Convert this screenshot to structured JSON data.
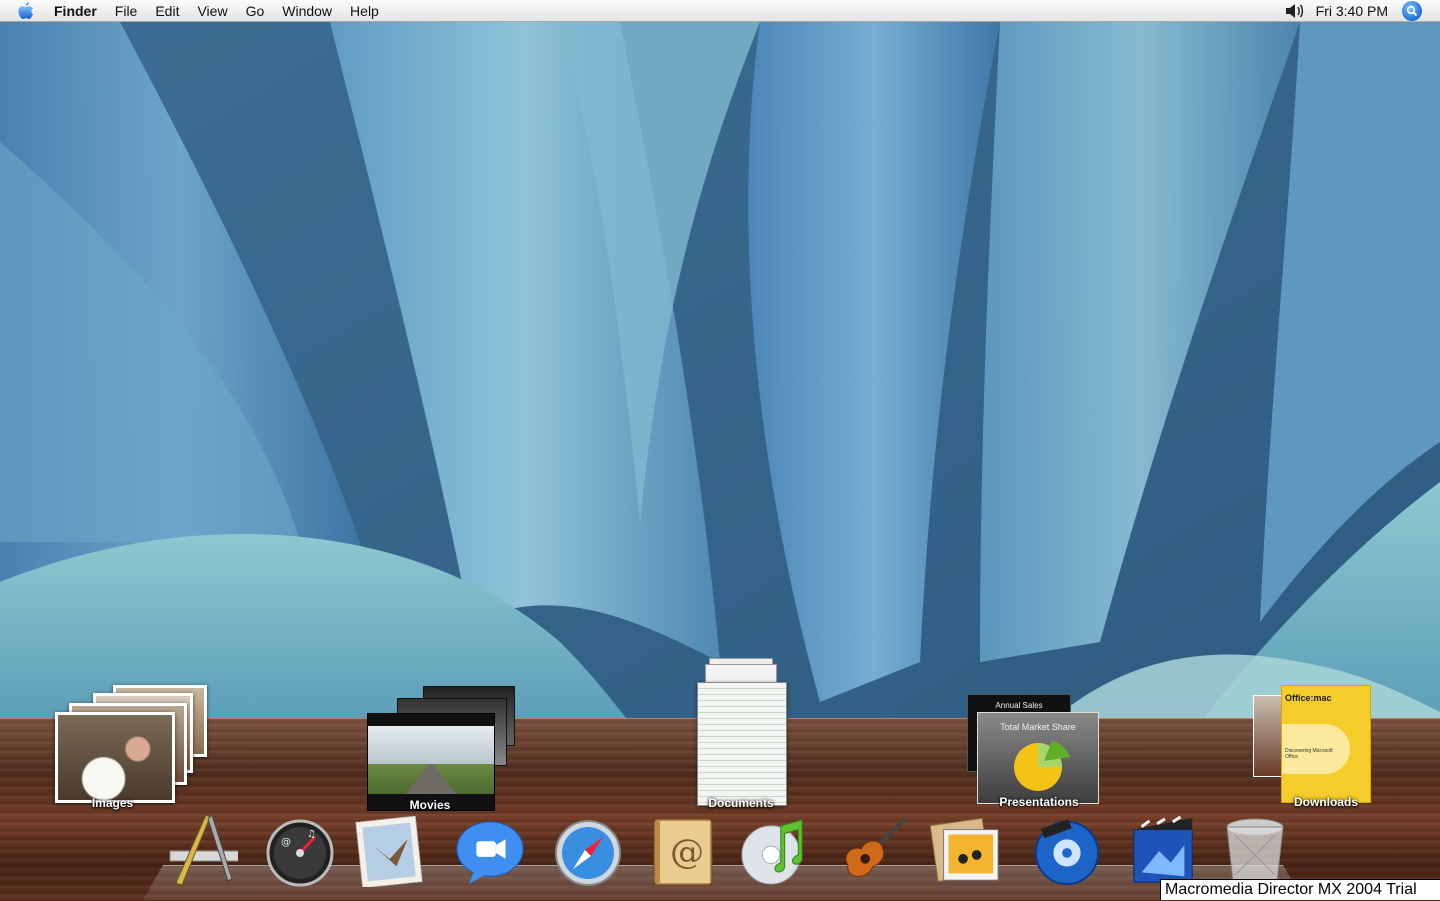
{
  "menubar": {
    "app_name": "Finder",
    "items": [
      "File",
      "Edit",
      "View",
      "Go",
      "Window",
      "Help"
    ],
    "clock": "Fri 3:40 PM"
  },
  "stacks": {
    "images": {
      "label": "Images"
    },
    "movies": {
      "label": "Movies"
    },
    "documents": {
      "label": "Documents"
    },
    "presentations": {
      "label": "Presentations",
      "card_title_back": "Annual Sales",
      "card_title_front": "Total Market Share"
    },
    "downloads": {
      "label": "Downloads",
      "brand": "Office:mac",
      "subtitle": "Discovering Microsoft Office"
    }
  },
  "dock": {
    "items": [
      "xcode-icon",
      "dashboard-icon",
      "mail-icon",
      "ichat-icon",
      "safari-icon",
      "address-book-icon",
      "itunes-icon",
      "garageband-icon",
      "iphoto-icon",
      "idvd-icon",
      "imovie-icon",
      "trash-icon"
    ]
  },
  "trial_banner": "Macromedia Director MX 2004 Trial",
  "colors": {
    "accent": "#1c6fd6",
    "wood": "#5e301d",
    "wallpaper": "#4a7fa8"
  }
}
